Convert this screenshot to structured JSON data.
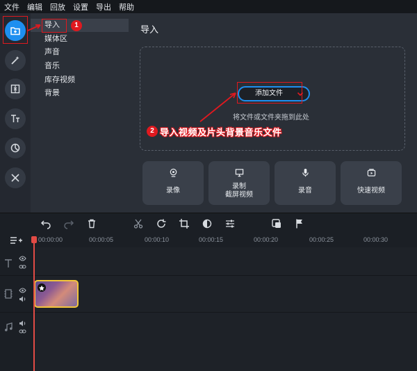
{
  "menu": [
    "文件",
    "编辑",
    "回放",
    "设置",
    "导出",
    "帮助"
  ],
  "subnav": {
    "items": [
      "导入",
      "媒体区",
      "声音",
      "音乐",
      "库存视频",
      "背景"
    ]
  },
  "main": {
    "title": "导入",
    "add_file_label": "添加文件",
    "drop_hint": "将文件或文件夹拖到此处",
    "tiles": [
      {
        "label": "录像",
        "icon": "webcam-icon"
      },
      {
        "label": "录制\n截屏视频",
        "icon": "screen-record-icon"
      },
      {
        "label": "录音",
        "icon": "microphone-icon"
      },
      {
        "label": "快速视频",
        "icon": "quick-video-icon"
      }
    ]
  },
  "annotations": {
    "badge1": "1",
    "badge2": "2",
    "note": "导入视频及片头背景音乐文件"
  },
  "timeline": {
    "ticks": [
      "00:00:00",
      "00:00:05",
      "00:00:10",
      "00:00:15",
      "00:00:20",
      "00:00:25",
      "00:00:30"
    ]
  },
  "colors": {
    "accent": "#1e8ff0",
    "annotation_red": "#e0191f",
    "playhead": "#e24b45",
    "clip_border": "#f3c63a"
  }
}
